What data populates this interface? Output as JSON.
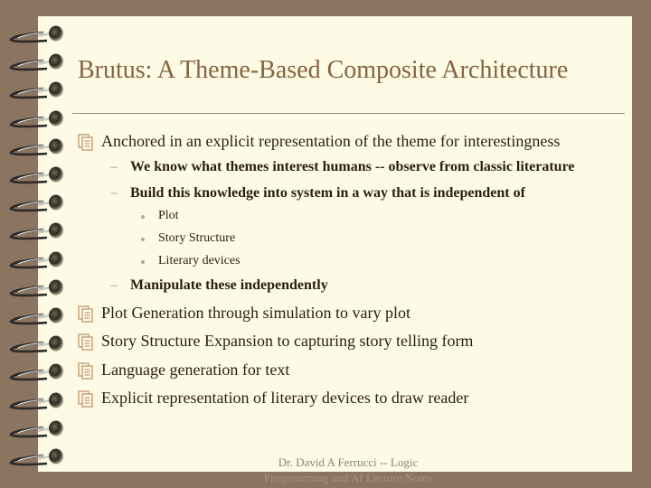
{
  "slide": {
    "title": "Brutus: A Theme-Based Composite Architecture",
    "bullets": [
      {
        "icon": "document-icon",
        "text": "Anchored in an explicit representation of the theme for interestingness",
        "sub": [
          {
            "text": "We know what themes interest humans -- observe from classic literature"
          },
          {
            "text": "Build this knowledge into system in a way that is independent of",
            "sub": [
              "Plot",
              "Story Structure",
              "Literary devices"
            ]
          },
          {
            "text": "Manipulate these  independently"
          }
        ]
      },
      {
        "icon": "document-icon",
        "text": "Plot Generation through simulation to vary plot"
      },
      {
        "icon": "document-icon",
        "text": "Story Structure Expansion to capturing story telling form"
      },
      {
        "icon": "document-icon",
        "text": "Language generation for text"
      },
      {
        "icon": "document-icon",
        "text": "Explicit representation of literary devices to draw reader"
      }
    ],
    "footer": {
      "line1": "Dr. David A Ferrucci   -- Logic",
      "line2": "Programming and AI Lecture Notes"
    }
  },
  "colors": {
    "background": "#8b7560",
    "page": "#fdfbe6",
    "title": "#86633f",
    "body_text": "#2b1e0c"
  }
}
